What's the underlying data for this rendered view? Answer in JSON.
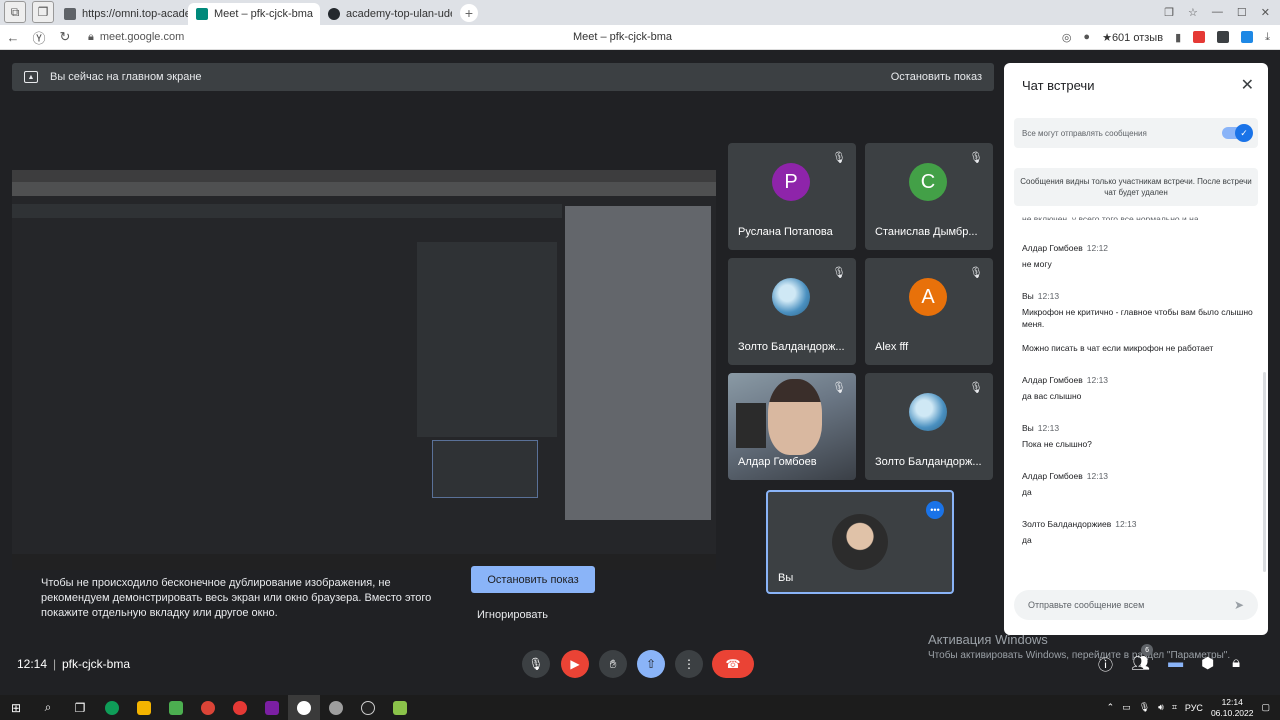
{
  "browser": {
    "tabs": [
      {
        "label": "https://omni.top-academ",
        "color": "#5f6368"
      },
      {
        "label": "Meet – pfk-cjck-bma",
        "color": "#00897b"
      },
      {
        "label": "academy-top-ulan-ude-p",
        "color": "#24292e"
      }
    ],
    "tab_close": "✕",
    "new_tab": "+",
    "url": "meet.google.com",
    "page_title": "Meet – pfk-cjck-bma",
    "reviews": "★601 отзыв"
  },
  "banner": {
    "text": "Вы сейчас на главном экране",
    "stop_label": "Остановить показ"
  },
  "participants": [
    {
      "name": "Руслана Потапова",
      "initial": "P",
      "color": "#8e24aa",
      "muted": true
    },
    {
      "name": "Станислав Дымбр...",
      "initial": "C",
      "color": "#43a047",
      "muted": true
    },
    {
      "name": "Золто Балдандорж...",
      "initial": "",
      "color": "#4a90c0",
      "muted": true
    },
    {
      "name": "Alex fff",
      "initial": "A",
      "color": "#e8710a",
      "muted": true
    },
    {
      "name": "Алдар Гомбоев",
      "initial": "",
      "color": "",
      "muted": false
    },
    {
      "name": "Золто Балдандорж...",
      "initial": "",
      "color": "#4a90c0",
      "muted": true
    }
  ],
  "self_tile": {
    "name": "Вы"
  },
  "warning": {
    "text": "Чтобы не происходило бесконечное дублирование изображения, не рекомендуем демонстрировать весь экран или окно браузера. Вместо этого покажите отдельную вкладку или другое окно.",
    "stop_label": "Остановить показ",
    "ignore_label": "Игнорировать"
  },
  "meeting": {
    "time": "12:14",
    "separator": "|",
    "code": "pfk-cjck-bma"
  },
  "chat": {
    "title": "Чат встречи",
    "toggle_label": "Все могут отправлять сообщения",
    "info": "Сообщения видны только участникам встречи. После встречи чат будет удален",
    "truncated": "не включен, у всего того все нормально и на",
    "messages": [
      {
        "author": "Алдар Гомбоев",
        "time": "12:12",
        "lines": [
          "не могу"
        ]
      },
      {
        "author": "Вы",
        "time": "12:13",
        "lines": [
          "Микрофон не критично - главное чтобы вам было слышно меня.",
          "Можно писать в чат если микрофон не работает"
        ]
      },
      {
        "author": "Алдар Гомбоев",
        "time": "12:13",
        "lines": [
          "да вас слышно"
        ]
      },
      {
        "author": "Вы",
        "time": "12:13",
        "lines": [
          "Пока не слышно?"
        ]
      },
      {
        "author": "Алдар Гомбоев",
        "time": "12:13",
        "lines": [
          "да"
        ]
      },
      {
        "author": "Золто Балдандоржиев",
        "time": "12:13",
        "lines": [
          "да"
        ]
      }
    ],
    "input_placeholder": "Отправьте сообщение всем"
  },
  "watermark": {
    "title": "Активация Windows",
    "text": "Чтобы активировать Windows, перейдите в раздел \"Параметры\"."
  },
  "right_controls": {
    "people_badge": "6"
  },
  "taskbar": {
    "lang": "РУС",
    "time": "12:14",
    "date": "06.10.2022"
  }
}
